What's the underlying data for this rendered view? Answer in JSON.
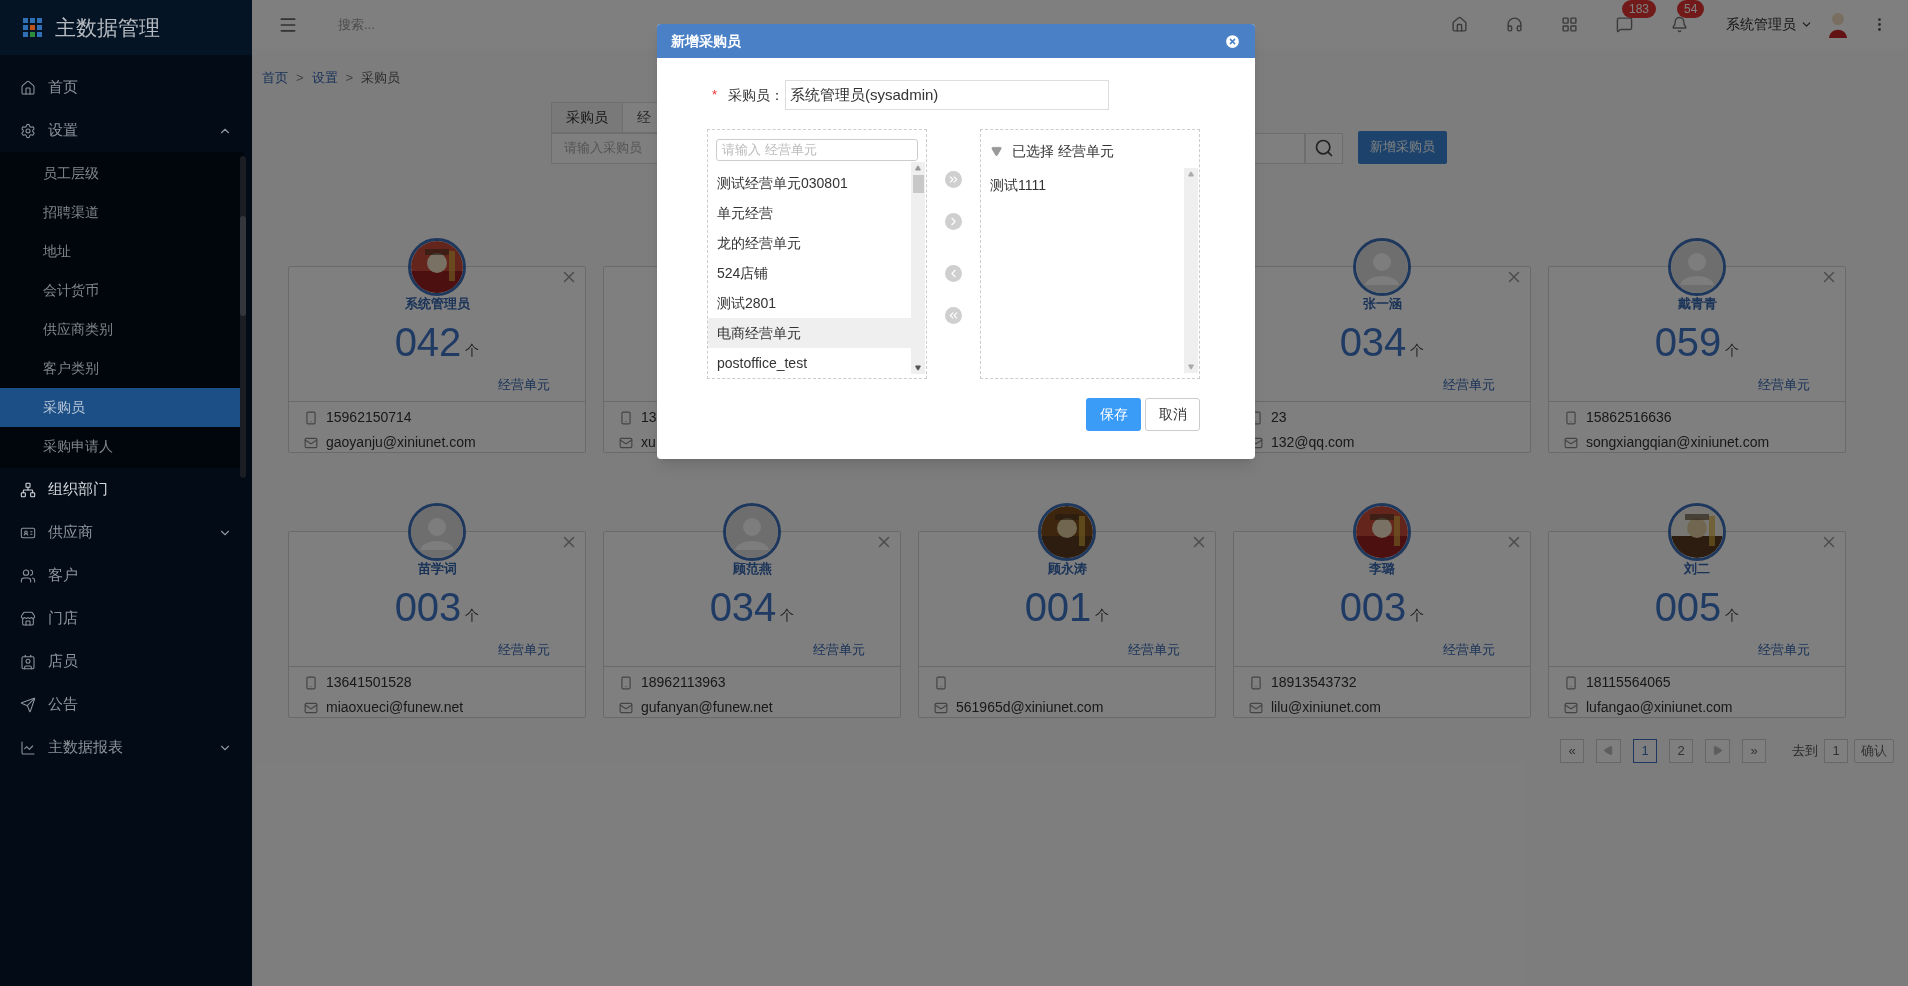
{
  "sidebar": {
    "title": "主数据管理",
    "items": [
      {
        "label": "首页",
        "highlighted": false
      },
      {
        "label": "设置",
        "highlighted": false,
        "expanded": true,
        "children": [
          {
            "label": "员工层级",
            "selected": false
          },
          {
            "label": "招聘渠道",
            "selected": false
          },
          {
            "label": "地址",
            "selected": false
          },
          {
            "label": "会计货币",
            "selected": false
          },
          {
            "label": "供应商类别",
            "selected": false
          },
          {
            "label": "客户类别",
            "selected": false
          },
          {
            "label": "采购员",
            "selected": true
          },
          {
            "label": "采购申请人",
            "selected": false
          }
        ]
      },
      {
        "label": "组织部门",
        "highlighted": true
      },
      {
        "label": "供应商",
        "highlighted": false,
        "expanded": false
      },
      {
        "label": "客户",
        "highlighted": false
      },
      {
        "label": "门店",
        "highlighted": false
      },
      {
        "label": "店员",
        "highlighted": false
      },
      {
        "label": "公告",
        "highlighted": false
      },
      {
        "label": "主数据报表",
        "highlighted": false,
        "expanded": false
      }
    ]
  },
  "topbar": {
    "search_placeholder": "搜索...",
    "badges": [
      "183",
      "54"
    ],
    "user": "系统管理员"
  },
  "breadcrumb": {
    "separator": ">",
    "items": [
      "首页",
      "设置",
      "采购员"
    ]
  },
  "tabs": [
    {
      "label": "采购员",
      "selected": true
    },
    {
      "label": "经",
      "selected": false
    }
  ],
  "search": {
    "placeholder": "请输入采购员",
    "add_button": "新增采购员"
  },
  "cards": [
    {
      "name": "系统管理员",
      "count": "042",
      "unit": "个",
      "caption": "经营单元",
      "phone": "15962150714",
      "email": "gaoyanju@xiniunet.com"
    },
    {
      "kind": "partial",
      "phone": "13",
      "email": "xu"
    },
    {
      "kind": "hidden"
    },
    {
      "kind": "plain",
      "name": "张一涵",
      "count": "034",
      "unit": "个",
      "caption": "经营单元",
      "phone": "23",
      "email": "132@qq.com"
    },
    {
      "kind": "plain",
      "name": "戴青青",
      "count": "059",
      "unit": "个",
      "caption": "经营单元",
      "phone": "15862516636",
      "email": "songxiangqian@xiniunet.com"
    },
    {
      "kind": "plain",
      "name": "苗学词",
      "count": "003",
      "unit": "个",
      "caption": "经营单元",
      "phone": "13641501528",
      "email": "miaoxueci@funew.net"
    },
    {
      "kind": "plain",
      "name": "顾范燕",
      "count": "034",
      "unit": "个",
      "caption": "经营单元",
      "phone": "18962113963",
      "email": "gufanyan@funew.net"
    },
    {
      "name": "顾永涛",
      "count": "001",
      "unit": "个",
      "caption": "经营单元",
      "email": "561965d@xiniunet.com"
    },
    {
      "name": "李璐",
      "count": "003",
      "unit": "个",
      "caption": "经营单元",
      "phone": "18913543732",
      "email": "lilu@xiniunet.com"
    },
    {
      "name": "刘二",
      "count": "005",
      "unit": "个",
      "caption": "经营单元",
      "phone": "18115564065",
      "email": "lufangao@xiniunet.com"
    }
  ],
  "pagination": {
    "first": "«",
    "last": "»",
    "pages": [
      {
        "label": "1",
        "selected": true
      },
      {
        "label": "2",
        "selected": false
      }
    ],
    "goto_label": "去到",
    "goto_value": "1",
    "confirm": "确认"
  },
  "dialog": {
    "title": "新增采购员",
    "required_mark": "*",
    "field_label": "采购员：",
    "field_value": "系统管理员(sysadmin)",
    "left_placeholder": "请输入 经营单元",
    "left_items": [
      {
        "label": "测试经营单元030801",
        "selected": false
      },
      {
        "label": "单元经营",
        "selected": false
      },
      {
        "label": "龙的经营单元",
        "selected": false
      },
      {
        "label": "524店铺",
        "selected": false
      },
      {
        "label": "测试2801",
        "selected": false
      },
      {
        "label": "电商经营单元",
        "selected": true
      },
      {
        "label": "postoffice_test",
        "selected": false
      }
    ],
    "right_title": "已选择 经营单元",
    "right_items": [
      "测试1111"
    ],
    "save": "保存",
    "cancel": "取消"
  }
}
